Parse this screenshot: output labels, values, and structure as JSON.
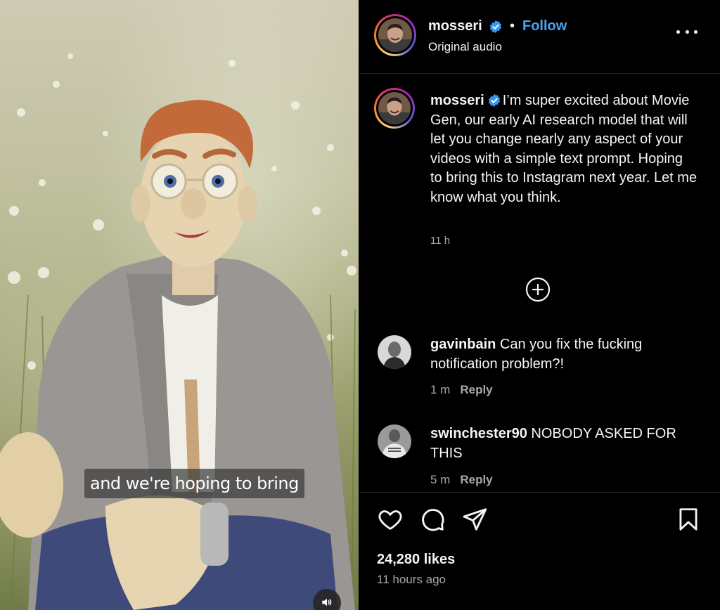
{
  "video": {
    "caption": "and we're hoping to bring",
    "mute_icon": "speaker-icon"
  },
  "header": {
    "username": "mosseri",
    "separator": "•",
    "follow_label": "Follow",
    "audio_label": "Original audio",
    "more_icon": "more-options-icon"
  },
  "post": {
    "username": "mosseri",
    "text": "I’m super excited about Movie Gen, our early AI research model that will let you change nearly any aspect of your videos with a simple text prompt. Hoping to bring this to Instagram next year. Let me know what you think.",
    "time": "11 h"
  },
  "comments": [
    {
      "username": "gavinbain",
      "text": "Can you fix the fucking notification problem?!",
      "time": "1 m",
      "reply_label": "Reply"
    },
    {
      "username": "swinchester90",
      "text": "NOBODY ASKED FOR THIS",
      "time": "5 m",
      "reply_label": "Reply"
    }
  ],
  "actions": {
    "likes": "24,280 likes",
    "posted": "11 hours ago"
  },
  "colors": {
    "accent": "#4aa3f5",
    "verified": "#3897f0",
    "muted_text": "#a8a8a8"
  }
}
